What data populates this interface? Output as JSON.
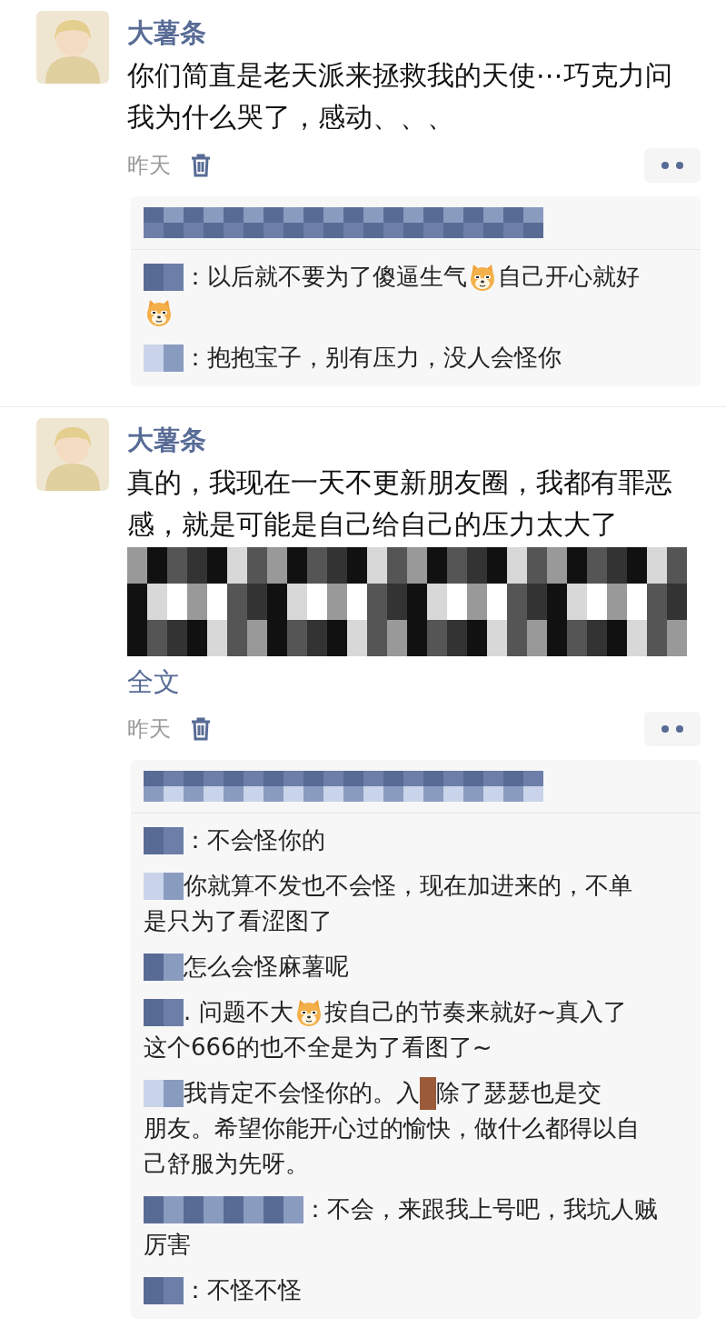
{
  "posts": [
    {
      "author": "大薯条",
      "text": "你们简直是老天派来拯救我的天使⋯巧克力问我为什么哭了，感动、、、",
      "text_mosaic": false,
      "time": "昨天",
      "likes": {
        "kind": "mosaic"
      },
      "comments": [
        {
          "lines": [
            [
              {
                "kind": "name_mosaic"
              },
              {
                "kind": "text",
                "text": "：以后就不要为了傻逼生气"
              },
              {
                "kind": "emoji"
              },
              {
                "kind": "text",
                "text": "自己开心就好"
              }
            ],
            [
              {
                "kind": "emoji"
              }
            ]
          ]
        },
        {
          "lines": [
            [
              {
                "kind": "name_mosaic"
              },
              {
                "kind": "text",
                "text": "：抱抱宝子，别有压力，没人会怪你"
              }
            ]
          ]
        }
      ]
    },
    {
      "author": "大薯条",
      "text": "真的，我现在一天不更新朋友圈，我都有罪恶感，就是可能是自己给自己的压力太大了",
      "text_mosaic": true,
      "expand_link": "全文",
      "time": "昨天",
      "likes": {
        "kind": "mosaic"
      },
      "comments": [
        {
          "lines": [
            [
              {
                "kind": "name_mosaic"
              },
              {
                "kind": "text",
                "text": "：不会怪你的"
              }
            ]
          ]
        },
        {
          "lines": [
            [
              {
                "kind": "name_mosaic"
              },
              {
                "kind": "text",
                "text": " 你就算不发也不会怪，现在加进来的，不单"
              }
            ],
            [
              {
                "kind": "text",
                "text": "是只为了看涩图了"
              }
            ]
          ]
        },
        {
          "lines": [
            [
              {
                "kind": "name_mosaic"
              },
              {
                "kind": "text",
                "text": " 怎么会怪麻薯呢"
              }
            ]
          ]
        },
        {
          "lines": [
            [
              {
                "kind": "name_mosaic"
              },
              {
                "kind": "text",
                "text": ". 问题不大"
              },
              {
                "kind": "emoji"
              },
              {
                "kind": "text",
                "text": "按自己的节奏来就好~真入了"
              }
            ],
            [
              {
                "kind": "text",
                "text": "这个666的也不全是为了看图了~"
              }
            ]
          ]
        },
        {
          "lines": [
            [
              {
                "kind": "name_mosaic"
              },
              {
                "kind": "text",
                "text": " 我肯定不会怪你的。入"
              },
              {
                "kind": "mosaic"
              },
              {
                "kind": "text",
                "text": "除了瑟瑟也是交"
              }
            ],
            [
              {
                "kind": "text",
                "text": "朋友。希望你能开心过的愉快，做什么都得以自"
              }
            ],
            [
              {
                "kind": "text",
                "text": "己舒服为先呀。"
              }
            ]
          ]
        },
        {
          "lines": [
            [
              {
                "kind": "name_mosaic_long"
              },
              {
                "kind": "text",
                "text": "：不会，来跟我上号吧，我坑人贼"
              }
            ],
            [
              {
                "kind": "text",
                "text": "厉害"
              }
            ]
          ]
        },
        {
          "lines": [
            [
              {
                "kind": "name_mosaic"
              },
              {
                "kind": "text",
                "text": "：不怪不怪"
              }
            ]
          ]
        }
      ]
    }
  ]
}
